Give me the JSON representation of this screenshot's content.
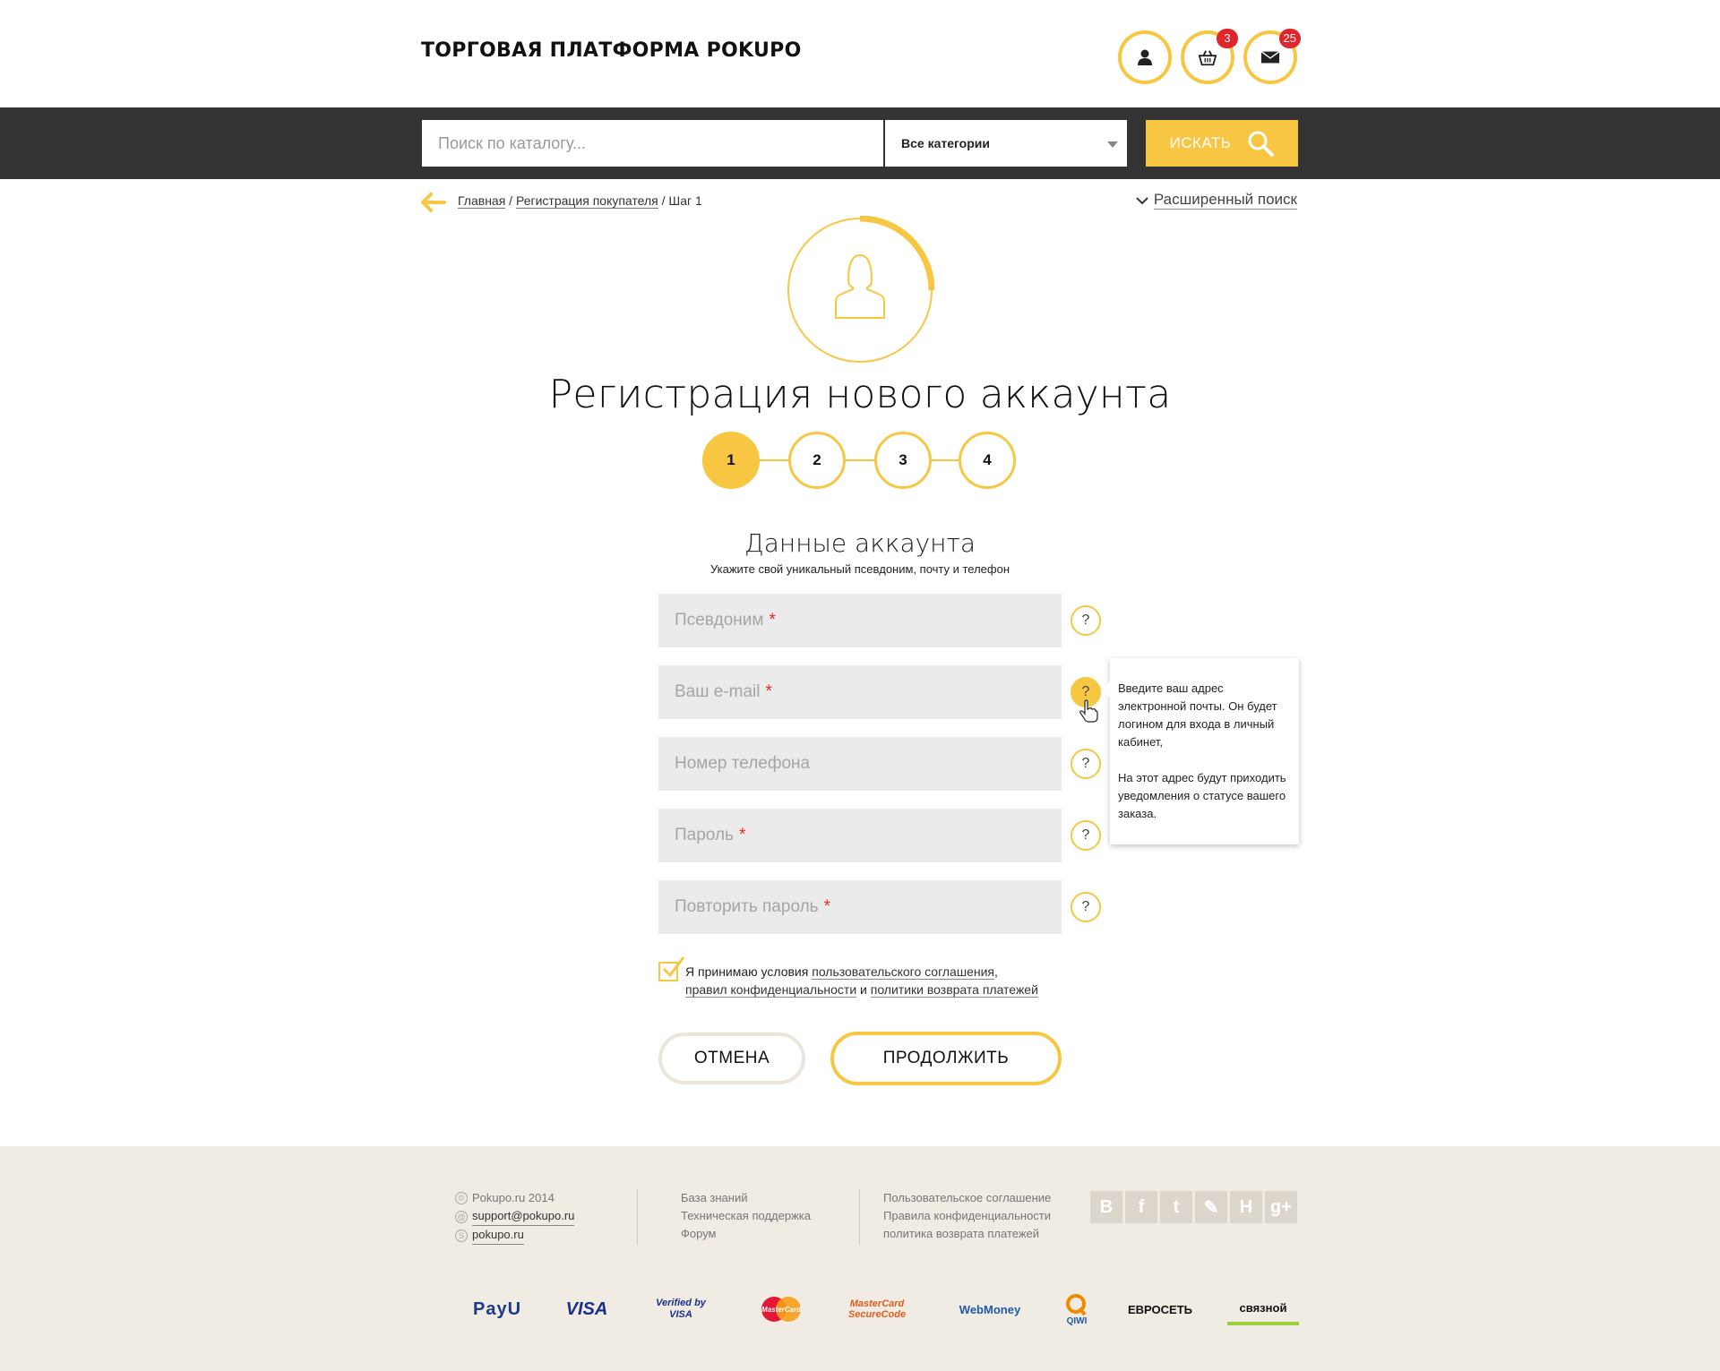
{
  "header": {
    "logo": "ТОРГОВАЯ ПЛАТФОРМА POKUPO",
    "cart_count": "3",
    "messages_count": "25"
  },
  "search": {
    "placeholder": "Поиск по каталогу...",
    "category": "Все категории",
    "button": "ИСКАТЬ"
  },
  "breadcrumb": {
    "home": "Главная",
    "sep1": " / ",
    "registration": "Регистрация покупателя",
    "sep2": " / ",
    "current": "Шаг 1"
  },
  "advanced_search": "Расширенный поиск",
  "page": {
    "title": "Регистрация нового аккаунта",
    "steps": [
      "1",
      "2",
      "3",
      "4"
    ],
    "active_step": 1,
    "section_title": "Данные аккаунта",
    "section_hint": "Укажите свой уникальный псевдоним, почту и телефон"
  },
  "form": {
    "fields": [
      {
        "placeholder": "Псевдоним",
        "required": "*"
      },
      {
        "placeholder": "Ваш e-mail",
        "required": "*"
      },
      {
        "placeholder": "Номер телефона",
        "required": ""
      },
      {
        "placeholder": "Пароль",
        "required": "*"
      },
      {
        "placeholder": "Повторить пароль",
        "required": "*"
      }
    ],
    "help_symbol": "?",
    "tooltip": {
      "p1": "Введите ваш адрес электронной почты. Он будет логином для входа в личный кабинет,",
      "p2": "На этот адрес будут приходить уведомления о статусе вашего заказа."
    },
    "agree": {
      "prefix": "Я принимаю условия ",
      "link1": "пользовательского соглашения",
      "comma": ",",
      "link2": "правил конфиденциальности",
      "and": " и ",
      "link3": "политики возврата платежей"
    },
    "cancel": "ОТМЕНА",
    "next": "ПРОДОЛЖИТЬ"
  },
  "footer": {
    "copyright": "Pokupo.ru 2014",
    "email": "support@pokupo.ru",
    "skype": "pokupo.ru",
    "col2": [
      "База знаний",
      "Техническая поддержка",
      "Форум"
    ],
    "col3": [
      "Пользовательское соглашение",
      "Правила конфиденциальности",
      "политика возврата платежей"
    ],
    "social": [
      "В",
      "f",
      "t",
      "✎",
      "H",
      "g+"
    ],
    "payments": [
      "PayU",
      "VISA",
      "Verified by VISA",
      "MasterCard",
      "MasterCard SecureCode",
      "WebMoney",
      "QIWI",
      "ЕВРОСЕТЬ",
      "связной"
    ]
  },
  "colors": {
    "accent": "#f7c744",
    "dark": "#333333",
    "badge": "#e1252d",
    "field_bg": "#ebebeb",
    "footer_bg": "#f0ebe3"
  }
}
